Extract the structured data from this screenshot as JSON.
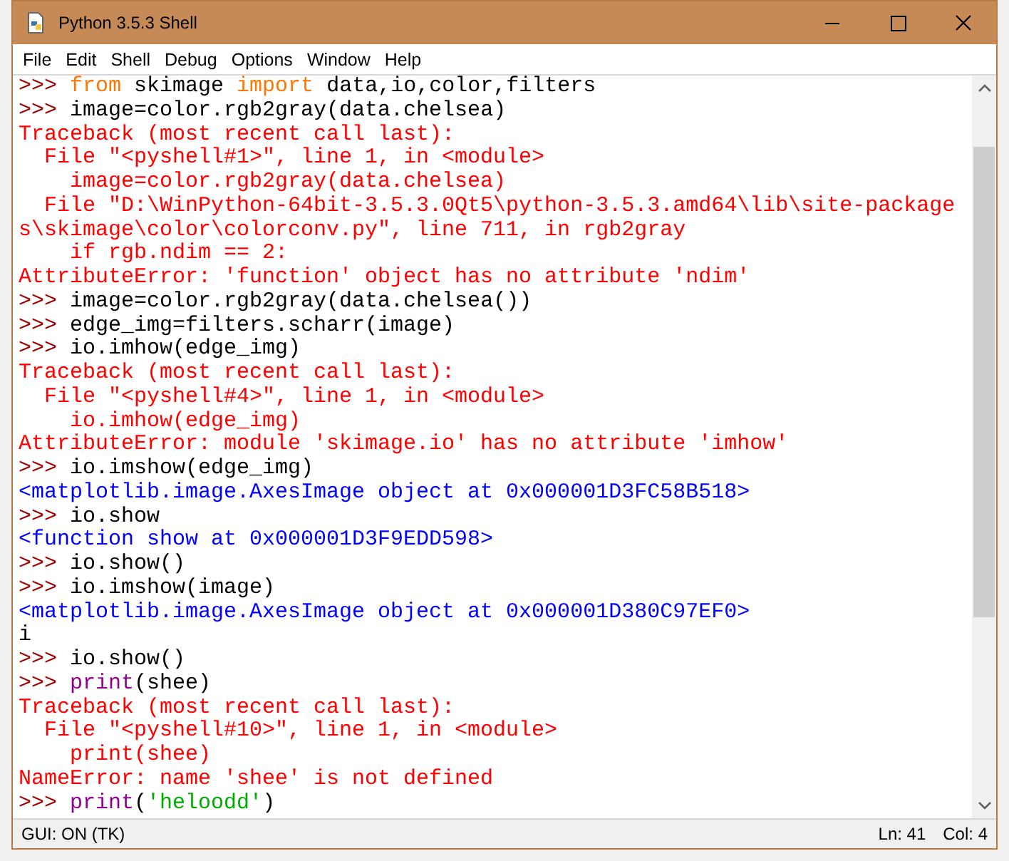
{
  "window": {
    "title": "Python 3.5.3 Shell"
  },
  "menu": [
    "File",
    "Edit",
    "Shell",
    "Debug",
    "Options",
    "Window",
    "Help"
  ],
  "lines": [
    [
      {
        "kind": "prompt",
        "text": ">>> "
      },
      {
        "kind": "keyword",
        "text": "from"
      },
      {
        "kind": "code",
        "text": " skimage "
      },
      {
        "kind": "keyword",
        "text": "import"
      },
      {
        "kind": "code",
        "text": " data,io,color,filters"
      }
    ],
    [
      {
        "kind": "prompt",
        "text": ">>> "
      },
      {
        "kind": "code",
        "text": "image=color.rgb2gray(data.chelsea)"
      }
    ],
    [
      {
        "kind": "error",
        "text": "Traceback (most recent call last):"
      }
    ],
    [
      {
        "kind": "error",
        "text": "  File \"<pyshell#1>\", line 1, in <module>"
      }
    ],
    [
      {
        "kind": "error",
        "text": "    image=color.rgb2gray(data.chelsea)"
      }
    ],
    [
      {
        "kind": "error",
        "text": "  File \"D:\\WinPython-64bit-3.5.3.0Qt5\\python-3.5.3.amd64\\lib\\site-package"
      }
    ],
    [
      {
        "kind": "error",
        "text": "s\\skimage\\color\\colorconv.py\", line 711, in rgb2gray"
      }
    ],
    [
      {
        "kind": "error",
        "text": "    if rgb.ndim == 2:"
      }
    ],
    [
      {
        "kind": "error",
        "text": "AttributeError: 'function' object has no attribute 'ndim'"
      }
    ],
    [
      {
        "kind": "prompt",
        "text": ">>> "
      },
      {
        "kind": "code",
        "text": "image=color.rgb2gray(data.chelsea())"
      }
    ],
    [
      {
        "kind": "prompt",
        "text": ">>> "
      },
      {
        "kind": "code",
        "text": "edge_img=filters.scharr(image)"
      }
    ],
    [
      {
        "kind": "prompt",
        "text": ">>> "
      },
      {
        "kind": "code",
        "text": "io.imhow(edge_img)"
      }
    ],
    [
      {
        "kind": "error",
        "text": "Traceback (most recent call last):"
      }
    ],
    [
      {
        "kind": "error",
        "text": "  File \"<pyshell#4>\", line 1, in <module>"
      }
    ],
    [
      {
        "kind": "error",
        "text": "    io.imhow(edge_img)"
      }
    ],
    [
      {
        "kind": "error",
        "text": "AttributeError: module 'skimage.io' has no attribute 'imhow'"
      }
    ],
    [
      {
        "kind": "prompt",
        "text": ">>> "
      },
      {
        "kind": "code",
        "text": "io.imshow(edge_img)"
      }
    ],
    [
      {
        "kind": "output",
        "text": "<matplotlib.image.AxesImage object at 0x000001D3FC58B518>"
      }
    ],
    [
      {
        "kind": "prompt",
        "text": ">>> "
      },
      {
        "kind": "code",
        "text": "io.show"
      }
    ],
    [
      {
        "kind": "output",
        "text": "<function show at 0x000001D3F9EDD598>"
      }
    ],
    [
      {
        "kind": "prompt",
        "text": ">>> "
      },
      {
        "kind": "code",
        "text": "io.show()"
      }
    ],
    [
      {
        "kind": "prompt",
        "text": ">>> "
      },
      {
        "kind": "code",
        "text": "io.imshow(image)"
      }
    ],
    [
      {
        "kind": "output",
        "text": "<matplotlib.image.AxesImage object at 0x000001D380C97EF0>"
      }
    ],
    [
      {
        "kind": "code",
        "text": "i"
      }
    ],
    [
      {
        "kind": "prompt",
        "text": ">>> "
      },
      {
        "kind": "code",
        "text": "io.show()"
      }
    ],
    [
      {
        "kind": "prompt",
        "text": ">>> "
      },
      {
        "kind": "builtin",
        "text": "print"
      },
      {
        "kind": "code",
        "text": "(shee)"
      }
    ],
    [
      {
        "kind": "error",
        "text": "Traceback (most recent call last):"
      }
    ],
    [
      {
        "kind": "error",
        "text": "  File \"<pyshell#10>\", line 1, in <module>"
      }
    ],
    [
      {
        "kind": "error",
        "text": "    print(shee)"
      }
    ],
    [
      {
        "kind": "error",
        "text": "NameError: name 'shee' is not defined"
      }
    ],
    [
      {
        "kind": "prompt",
        "text": ">>> "
      },
      {
        "kind": "builtin",
        "text": "print"
      },
      {
        "kind": "code",
        "text": "("
      },
      {
        "kind": "string",
        "text": "'heloodd'"
      },
      {
        "kind": "code",
        "text": ")"
      }
    ]
  ],
  "status_bar": {
    "left": "GUI: ON (TK)",
    "line": "Ln: 41",
    "col": "Col: 4"
  }
}
